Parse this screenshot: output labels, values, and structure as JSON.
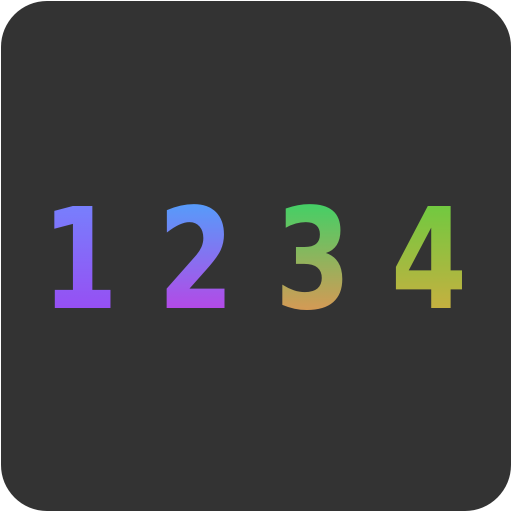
{
  "digits": [
    {
      "text": "1",
      "gradient": [
        "#6f8cff",
        "#a040f0"
      ]
    },
    {
      "text": "2",
      "gradient": [
        "#3fb0ff",
        "#d030e0"
      ]
    },
    {
      "text": "3",
      "gradient": [
        "#20dd6a",
        "#ff8a50"
      ]
    },
    {
      "text": "4",
      "gradient": [
        "#5ad040",
        "#e0a840"
      ]
    }
  ],
  "colors": {
    "background": "#333333"
  }
}
